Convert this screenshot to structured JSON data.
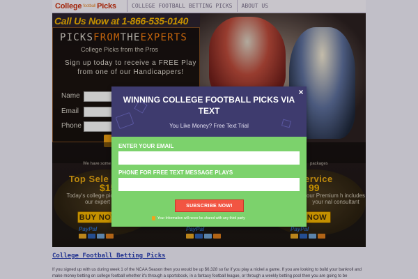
{
  "nav": {
    "logo_college": "College",
    "logo_football": "football",
    "logo_picks": "Picks",
    "items": [
      {
        "label": "COLLEGE FOOTBALL BETTING PICKS"
      },
      {
        "label": "ABOUT US"
      }
    ]
  },
  "hero": {
    "call_us": "Call Us Now at 1-866-535-0140",
    "brand_picks": "PICKS",
    "brand_from": "FROM",
    "brand_the": "THE",
    "brand_experts": "EXPERTS",
    "brand_sub": "College Picks from the Pros",
    "signup_text": "Sign up today to receive a FREE Play from one of our Handicappers!",
    "form": {
      "name_label": "Name",
      "email_label": "Email",
      "phone_label": "Phone"
    },
    "band_left": "We have some",
    "band_right": "packages",
    "left_title": "Top Sele",
    "left_price": "$15",
    "left_desc": "Today's college pick from our expert",
    "right_title": "Service",
    "right_price": "99",
    "right_desc": "our Premium h includes your nal consultant",
    "buy_now": "BUY NOW",
    "buy_now_right": "NOW",
    "paypal": "PayPal"
  },
  "content": {
    "section_title": "College Football Betting Picks",
    "paragraph": "If you signed up with us during week 1 of the NCAA Season then you would be up $6,328 so far if you play a nickel a game. If you are looking to build your bankroll and make money betting on college football whether it's through a sportsbook, in a fantasy football league, or through a weekly betting pool then you are going to be"
  },
  "modal": {
    "title": "WINNING COLLEGE FOOTBALL PICKS VIA TEXT",
    "subtitle": "You Like Money? Free Text Trial",
    "close_label": "×",
    "email_label": "ENTER YOUR EMAIL",
    "phone_label": "PHONE FOR FREE TEXT MESSAGE PLAYS",
    "subscribe_label": "SUBSCRIBE NOW!",
    "privacy_text": "Your Information will never be shared with any third party",
    "colors": {
      "header": "#3e3b6e",
      "body": "#7cd26c",
      "button": "#f25542"
    }
  }
}
